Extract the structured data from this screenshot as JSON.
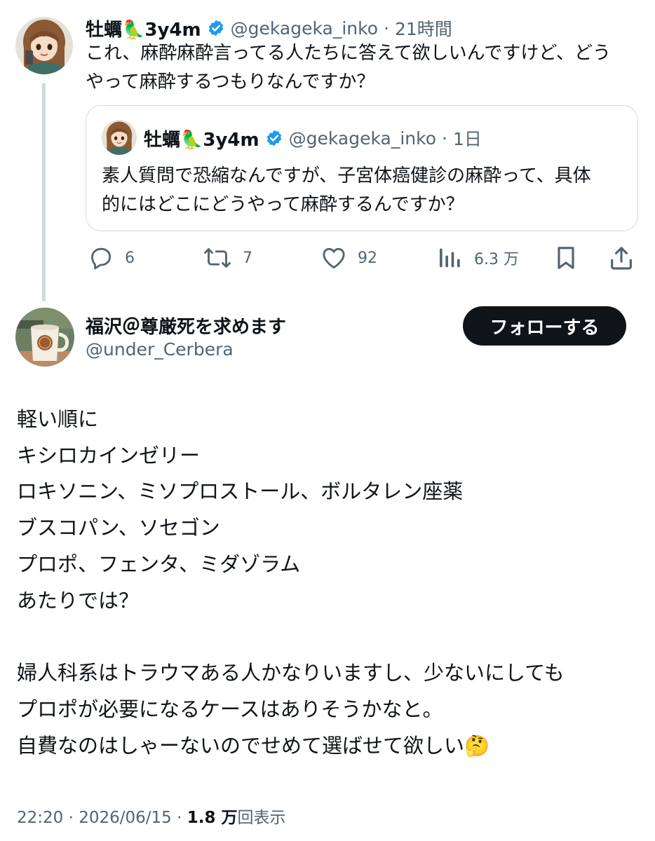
{
  "colors": {
    "text": "#0f1419",
    "secondary": "#536471",
    "border": "#cfd9de",
    "verified": "#1d9bf0",
    "follow_bg": "#0f1419"
  },
  "parent_tweet": {
    "author_name": "牡蠣🦜3y4m",
    "handle": "@gekageka_inko",
    "separator": "·",
    "time": "21時間",
    "text_line1": "これ、麻酔麻酔言ってる人たちに答えて欲しいんですけど、どう",
    "text_line2": "やって麻酔するつもりなんですか？",
    "quote": {
      "author_name": "牡蠣🦜3y4m",
      "handle": "@gekageka_inko",
      "separator": "·",
      "time": "1日",
      "text_line1": "素人質問で恐縮なんですが、子宮体癌健診の麻酔って、具体",
      "text_line2": "的にはどこにどうやって麻酔するんですか？"
    },
    "actions": {
      "reply_icon": "reply-icon",
      "reply_count": "6",
      "retweet_icon": "retweet-icon",
      "retweet_count": "7",
      "like_icon": "heart-icon",
      "like_count": "92",
      "views_icon": "views-bar-icon",
      "views_count": "6.3 万",
      "bookmark_icon": "bookmark-icon",
      "share_icon": "share-icon"
    }
  },
  "main_tweet": {
    "author_name": "福沢＠尊厳死を求めます",
    "handle": "@under_Cerbera",
    "follow_label": "フォローする",
    "lines": [
      "軽い順に",
      "キシロカインゼリー",
      "ロキソニン、ミソプロストール、ボルタレン座薬",
      "ブスコパン、ソセゴン",
      "プロポ、フェンタ、ミダゾラム",
      "あたりでは？",
      "婦人科系はトラウマある人かなりいますし、少ないにしても",
      "プロポが必要になるケースはありそうかなと。",
      "自費なのはしゃーないのでせめて選ばせて欲しい🤔"
    ],
    "footer": {
      "time": "22:20",
      "sep1": "·",
      "date": "2026/06/15",
      "sep2": "·",
      "views_count": "1.8 万",
      "views_label": "回表示"
    }
  }
}
